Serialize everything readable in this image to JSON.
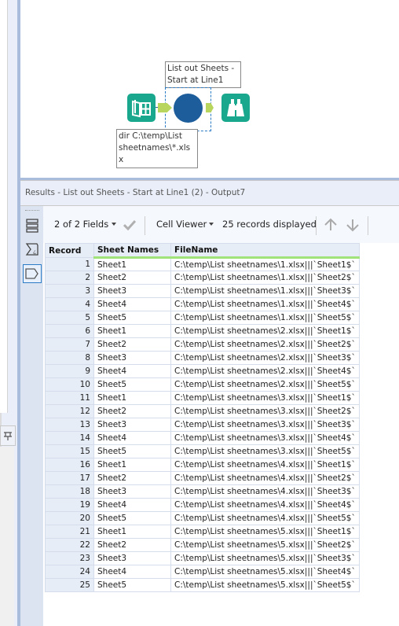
{
  "canvas": {
    "tool_annotation": "List out Sheets -\nStart at Line1",
    "input_annotation": "dir C:\\temp\\List\nsheetnames\\*.xls\nx"
  },
  "results": {
    "title": "Results - List out Sheets - Start at Line1 (2) - Output7",
    "toolbar": {
      "fields_label": "2 of 2 Fields",
      "viewer_label": "Cell Viewer",
      "records_label": "25 records displayed"
    },
    "columns": [
      "Record",
      "Sheet Names",
      "FileName"
    ],
    "rows": [
      {
        "record": "1",
        "sheet": "Sheet1",
        "file": "C:\\temp\\List sheetnames\\1.xlsx|||`Sheet1$`"
      },
      {
        "record": "2",
        "sheet": "Sheet2",
        "file": "C:\\temp\\List sheetnames\\1.xlsx|||`Sheet2$`"
      },
      {
        "record": "3",
        "sheet": "Sheet3",
        "file": "C:\\temp\\List sheetnames\\1.xlsx|||`Sheet3$`"
      },
      {
        "record": "4",
        "sheet": "Sheet4",
        "file": "C:\\temp\\List sheetnames\\1.xlsx|||`Sheet4$`"
      },
      {
        "record": "5",
        "sheet": "Sheet5",
        "file": "C:\\temp\\List sheetnames\\1.xlsx|||`Sheet5$`"
      },
      {
        "record": "6",
        "sheet": "Sheet1",
        "file": "C:\\temp\\List sheetnames\\2.xlsx|||`Sheet1$`"
      },
      {
        "record": "7",
        "sheet": "Sheet2",
        "file": "C:\\temp\\List sheetnames\\2.xlsx|||`Sheet2$`"
      },
      {
        "record": "8",
        "sheet": "Sheet3",
        "file": "C:\\temp\\List sheetnames\\2.xlsx|||`Sheet3$`"
      },
      {
        "record": "9",
        "sheet": "Sheet4",
        "file": "C:\\temp\\List sheetnames\\2.xlsx|||`Sheet4$`"
      },
      {
        "record": "10",
        "sheet": "Sheet5",
        "file": "C:\\temp\\List sheetnames\\2.xlsx|||`Sheet5$`"
      },
      {
        "record": "11",
        "sheet": "Sheet1",
        "file": "C:\\temp\\List sheetnames\\3.xlsx|||`Sheet1$`"
      },
      {
        "record": "12",
        "sheet": "Sheet2",
        "file": "C:\\temp\\List sheetnames\\3.xlsx|||`Sheet2$`"
      },
      {
        "record": "13",
        "sheet": "Sheet3",
        "file": "C:\\temp\\List sheetnames\\3.xlsx|||`Sheet3$`"
      },
      {
        "record": "14",
        "sheet": "Sheet4",
        "file": "C:\\temp\\List sheetnames\\3.xlsx|||`Sheet4$`"
      },
      {
        "record": "15",
        "sheet": "Sheet5",
        "file": "C:\\temp\\List sheetnames\\3.xlsx|||`Sheet5$`"
      },
      {
        "record": "16",
        "sheet": "Sheet1",
        "file": "C:\\temp\\List sheetnames\\4.xlsx|||`Sheet1$`"
      },
      {
        "record": "17",
        "sheet": "Sheet2",
        "file": "C:\\temp\\List sheetnames\\4.xlsx|||`Sheet2$`"
      },
      {
        "record": "18",
        "sheet": "Sheet3",
        "file": "C:\\temp\\List sheetnames\\4.xlsx|||`Sheet3$`"
      },
      {
        "record": "19",
        "sheet": "Sheet4",
        "file": "C:\\temp\\List sheetnames\\4.xlsx|||`Sheet4$`"
      },
      {
        "record": "20",
        "sheet": "Sheet5",
        "file": "C:\\temp\\List sheetnames\\4.xlsx|||`Sheet5$`"
      },
      {
        "record": "21",
        "sheet": "Sheet1",
        "file": "C:\\temp\\List sheetnames\\5.xlsx|||`Sheet1$`"
      },
      {
        "record": "22",
        "sheet": "Sheet2",
        "file": "C:\\temp\\List sheetnames\\5.xlsx|||`Sheet2$`"
      },
      {
        "record": "23",
        "sheet": "Sheet3",
        "file": "C:\\temp\\List sheetnames\\5.xlsx|||`Sheet3$`"
      },
      {
        "record": "24",
        "sheet": "Sheet4",
        "file": "C:\\temp\\List sheetnames\\5.xlsx|||`Sheet4$`"
      },
      {
        "record": "25",
        "sheet": "Sheet5",
        "file": "C:\\temp\\List sheetnames\\5.xlsx|||`Sheet5$`"
      }
    ]
  },
  "colors": {
    "tool_teal": "#19a88d",
    "tool_blue": "#1d5d9b",
    "anchor_green": "#b8d55e",
    "header_underline_green": "#9fe37a",
    "panel_divider": "#a9bcdc"
  }
}
